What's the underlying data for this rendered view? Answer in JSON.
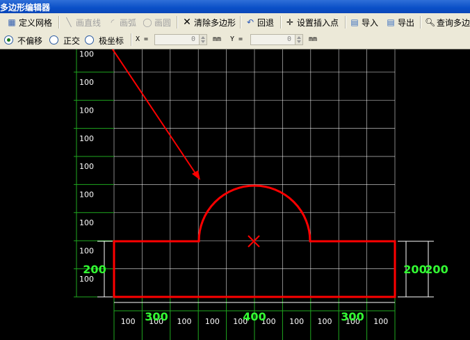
{
  "window": {
    "title": "多边形编辑器"
  },
  "toolbar": {
    "define_grid": "定义网格",
    "draw_line": "画直线",
    "draw_arc": "画弧",
    "draw_circle": "画圆",
    "clear_polygon": "清除多边形",
    "undo": "回退",
    "set_insert_point": "设置插入点",
    "import": "导入",
    "export": "导出",
    "query": "查询多边"
  },
  "options": {
    "no_offset": "不偏移",
    "ortho": "正交",
    "polar": "极坐标",
    "selected": "no_offset",
    "x_label": "X =",
    "x_value": "0",
    "x_unit": "mm",
    "y_label": "Y =",
    "y_value": "0",
    "y_unit": "mm"
  },
  "drawing": {
    "row_labels": [
      "100",
      "100",
      "100",
      "100",
      "100",
      "100",
      "100",
      "100",
      "100"
    ],
    "col_labels": [
      "100",
      "100",
      "100",
      "100",
      "100",
      "100",
      "100",
      "100",
      "100",
      "100"
    ],
    "dims_bottom": [
      "300",
      "400",
      "300"
    ],
    "dim_left": "200",
    "dims_right": [
      "200",
      "200"
    ],
    "colors": {
      "grid": "#ffffff",
      "dimension": "#1fa81f",
      "dim_text": "#33ff33",
      "shape": "#ff0000",
      "annotation": "#ff0000"
    }
  }
}
